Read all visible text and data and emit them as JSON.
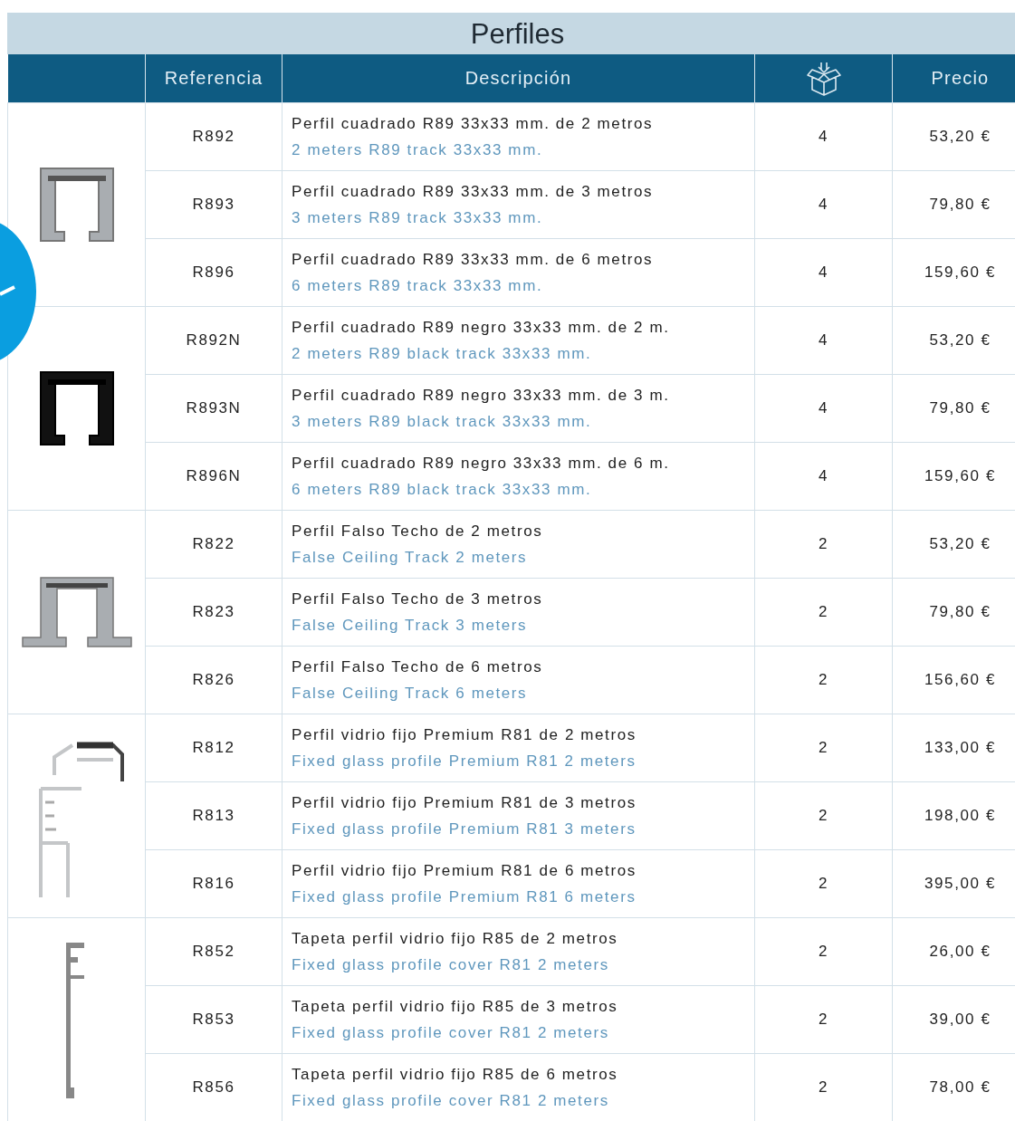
{
  "title": "Perfiles",
  "columns": {
    "reference": "Referencia",
    "description": "Descripción",
    "price": "Precio"
  },
  "groups": [
    {
      "kind": "square-grey",
      "rows": [
        {
          "ref": "R892",
          "desc": "Perfil cuadrado R89 33x33 mm. de 2 metros",
          "desc_en": "2 meters R89 track 33x33 mm.",
          "qty": "4",
          "price": "53,20 €"
        },
        {
          "ref": "R893",
          "desc": "Perfil cuadrado R89 33x33 mm. de 3 metros",
          "desc_en": "3 meters R89 track 33x33 mm.",
          "qty": "4",
          "price": "79,80 €"
        },
        {
          "ref": "R896",
          "desc": "Perfil cuadrado R89 33x33 mm. de 6 metros",
          "desc_en": "6 meters R89 track 33x33 mm.",
          "qty": "4",
          "price": "159,60 €"
        }
      ]
    },
    {
      "kind": "square-black",
      "rows": [
        {
          "ref": "R892N",
          "desc": "Perfil cuadrado R89 negro 33x33 mm. de 2 m.",
          "desc_en": "2 meters R89 black track 33x33 mm.",
          "qty": "4",
          "price": "53,20 €"
        },
        {
          "ref": "R893N",
          "desc": "Perfil cuadrado R89 negro 33x33 mm. de 3 m.",
          "desc_en": "3 meters R89 black track 33x33 mm.",
          "qty": "4",
          "price": "79,80 €"
        },
        {
          "ref": "R896N",
          "desc": "Perfil cuadrado R89 negro 33x33 mm. de 6 m.",
          "desc_en": "6 meters R89 black track 33x33 mm.",
          "qty": "4",
          "price": "159,60 €"
        }
      ]
    },
    {
      "kind": "ceiling",
      "rows": [
        {
          "ref": "R822",
          "desc": "Perfil Falso Techo de 2 metros",
          "desc_en": "False Ceiling Track 2 meters",
          "qty": "2",
          "price": "53,20 €"
        },
        {
          "ref": "R823",
          "desc": "Perfil Falso Techo de 3 metros",
          "desc_en": "False Ceiling Track 3 meters",
          "qty": "2",
          "price": "79,80 €"
        },
        {
          "ref": "R826",
          "desc": "Perfil Falso Techo de 6 metros",
          "desc_en": "False Ceiling Track 6 meters",
          "qty": "2",
          "price": "156,60 €"
        }
      ]
    },
    {
      "kind": "glass",
      "rows": [
        {
          "ref": "R812",
          "desc": "Perfil vidrio fijo Premium R81 de 2 metros",
          "desc_en": "Fixed glass profile Premium R81 2 meters",
          "qty": "2",
          "price": "133,00 €"
        },
        {
          "ref": "R813",
          "desc": "Perfil vidrio fijo Premium R81 de 3 metros",
          "desc_en": "Fixed glass profile Premium R81 3 meters",
          "qty": "2",
          "price": "198,00 €"
        },
        {
          "ref": "R816",
          "desc": "Perfil vidrio fijo Premium R81 de 6 metros",
          "desc_en": "Fixed glass profile Premium R81 6 meters",
          "qty": "2",
          "price": "395,00 €"
        }
      ]
    },
    {
      "kind": "cover",
      "rows": [
        {
          "ref": "R852",
          "desc": "Tapeta perfil vidrio fijo R85 de 2 metros",
          "desc_en": "Fixed glass profile cover R81 2 meters",
          "qty": "2",
          "price": "26,00 €"
        },
        {
          "ref": "R853",
          "desc": "Tapeta perfil vidrio fijo R85 de 3 metros",
          "desc_en": "Fixed glass profile cover R81 2 meters",
          "qty": "2",
          "price": "39,00 €"
        },
        {
          "ref": "R856",
          "desc": "Tapeta perfil vidrio fijo R85 de 6 metros",
          "desc_en": "Fixed glass profile cover R81 2 meters",
          "qty": "2",
          "price": "78,00 €"
        }
      ]
    }
  ]
}
